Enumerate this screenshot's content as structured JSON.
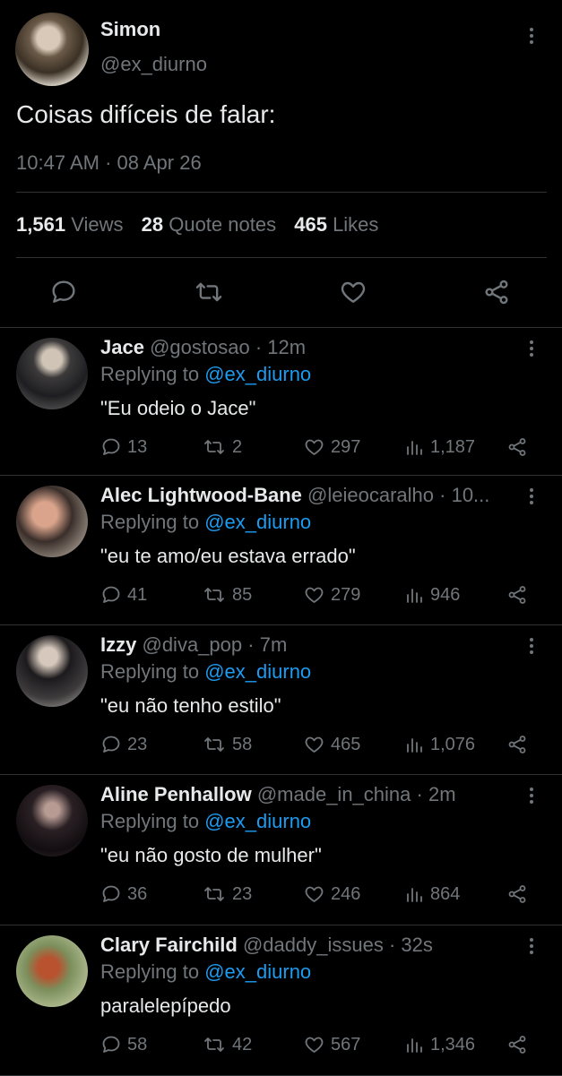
{
  "main": {
    "name": "Simon",
    "handle": "@ex_diurno",
    "text": "Coisas difíceis de falar:",
    "time": "10:47 AM · 08 Apr 26",
    "stats": {
      "views_num": "1,561",
      "views_label": "Views",
      "quotes_num": "28",
      "quotes_label": "Quote notes",
      "likes_num": "465",
      "likes_label": "Likes"
    }
  },
  "replies": [
    {
      "name": "Jace",
      "handle": "@gostosao",
      "time": "12m",
      "replying_label": "Replying to",
      "replying_to": "@ex_diurno",
      "text": "\"Eu odeio o Jace\"",
      "comments": "13",
      "retweets": "2",
      "likes": "297",
      "views": "1,187"
    },
    {
      "name": "Alec Lightwood-Bane",
      "handle": "@leieocaralho",
      "time": "10...",
      "replying_label": "Replying to",
      "replying_to": "@ex_diurno",
      "text": "\"eu te amo/eu estava errado\"",
      "comments": "41",
      "retweets": "85",
      "likes": "279",
      "views": "946"
    },
    {
      "name": "Izzy",
      "handle": "@diva_pop",
      "time": "7m",
      "replying_label": "Replying to",
      "replying_to": "@ex_diurno",
      "text": "\"eu não tenho estilo\"",
      "comments": "23",
      "retweets": "58",
      "likes": "465",
      "views": "1,076"
    },
    {
      "name": "Aline Penhallow",
      "handle": "@made_in_china",
      "time": "2m",
      "replying_label": "Replying to",
      "replying_to": "@ex_diurno",
      "text": "\"eu não gosto de mulher\"",
      "comments": "36",
      "retweets": "23",
      "likes": "246",
      "views": "864"
    },
    {
      "name": "Clary Fairchild",
      "handle": "@daddy_issues",
      "time": "32s",
      "replying_label": "Replying to",
      "replying_to": "@ex_diurno",
      "text": "paralelepípedo",
      "comments": "58",
      "retweets": "42",
      "likes": "567",
      "views": "1,346"
    }
  ],
  "icons": {
    "comment": "comment-icon",
    "retweet": "retweet-icon",
    "like": "heart-icon",
    "views": "views-icon",
    "share": "share-icon",
    "more": "more-vertical-icon"
  },
  "colors": {
    "background": "#000000",
    "text": "#e7e9ea",
    "muted": "#71767b",
    "link": "#1d9bf0",
    "divider": "#2f3336"
  }
}
